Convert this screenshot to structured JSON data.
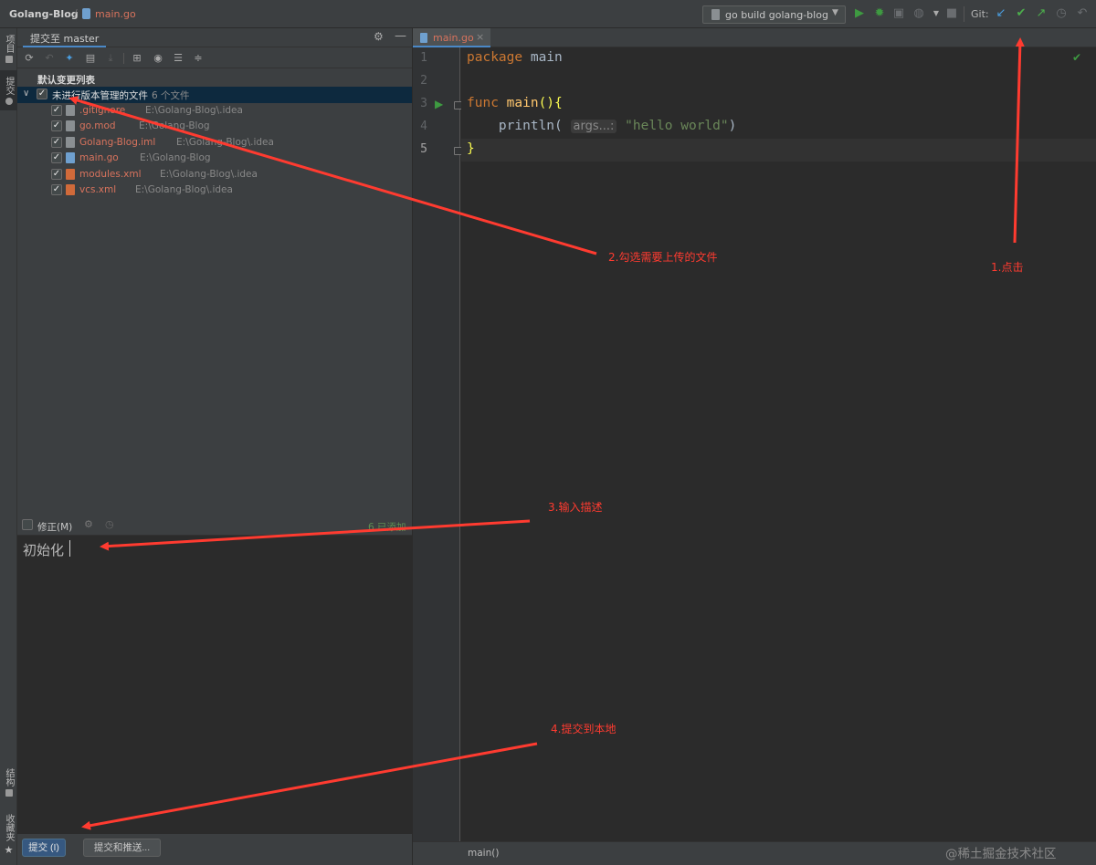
{
  "nav": {
    "project": "Golang-Blog",
    "file": "main.go",
    "run_config": "go build golang-blog",
    "git_label": "Git:"
  },
  "left_strip": {
    "project": "项目",
    "commit": "提交",
    "structure": "结构",
    "favorites": "收藏夹"
  },
  "commit_panel": {
    "tab": "提交至 master",
    "changelist": "默认变更列表",
    "group": {
      "label": "未进行版本管理的文件",
      "count": "6 个文件"
    },
    "files": [
      {
        "name": ".gitignore",
        "path": "E:\\Golang-Blog\\.idea",
        "icon_color": "#8a8f92"
      },
      {
        "name": "go.mod",
        "path": "E:\\Golang-Blog",
        "icon_color": "#8a8f92"
      },
      {
        "name": "Golang-Blog.iml",
        "path": "E:\\Golang-Blog\\.idea",
        "icon_color": "#8a8f92"
      },
      {
        "name": "main.go",
        "path": "E:\\Golang-Blog",
        "icon_color": "#6fa0cf"
      },
      {
        "name": "modules.xml",
        "path": "E:\\Golang-Blog\\.idea",
        "icon_color": "#d06a3a"
      },
      {
        "name": "vcs.xml",
        "path": "E:\\Golang-Blog\\.idea",
        "icon_color": "#d06a3a"
      }
    ],
    "amend_label": "修正(M)",
    "added": "6 已添加",
    "message": "初始化",
    "commit_button": "提交 (I)",
    "commit_push_button": "提交和推送..."
  },
  "editor": {
    "tab": "main.go",
    "line_numbers": [
      "1",
      "2",
      "3",
      "4",
      "5"
    ],
    "code": {
      "l1_kw": "package",
      "l1_name": " main",
      "l3_kw": "func",
      "l3_name": "main",
      "l3_rest": "(){",
      "l4_fn": "println(",
      "l4_hint": "args...:",
      "l4_str": "\"hello world\"",
      "l4_close": ")",
      "l5": "}"
    },
    "breadcrumb": "main()"
  },
  "watermark": "@稀土掘金技术社区",
  "annotations": {
    "step1": "1.点击",
    "step2": "2.勾选需要上传的文件",
    "step3": "3.输入描述",
    "step4": "4.提交到本地"
  },
  "colors": {
    "accent": "#4a88c7",
    "annotation": "#ff3b30",
    "file_new": "#d8735d",
    "run_green": "#3e9a41"
  }
}
